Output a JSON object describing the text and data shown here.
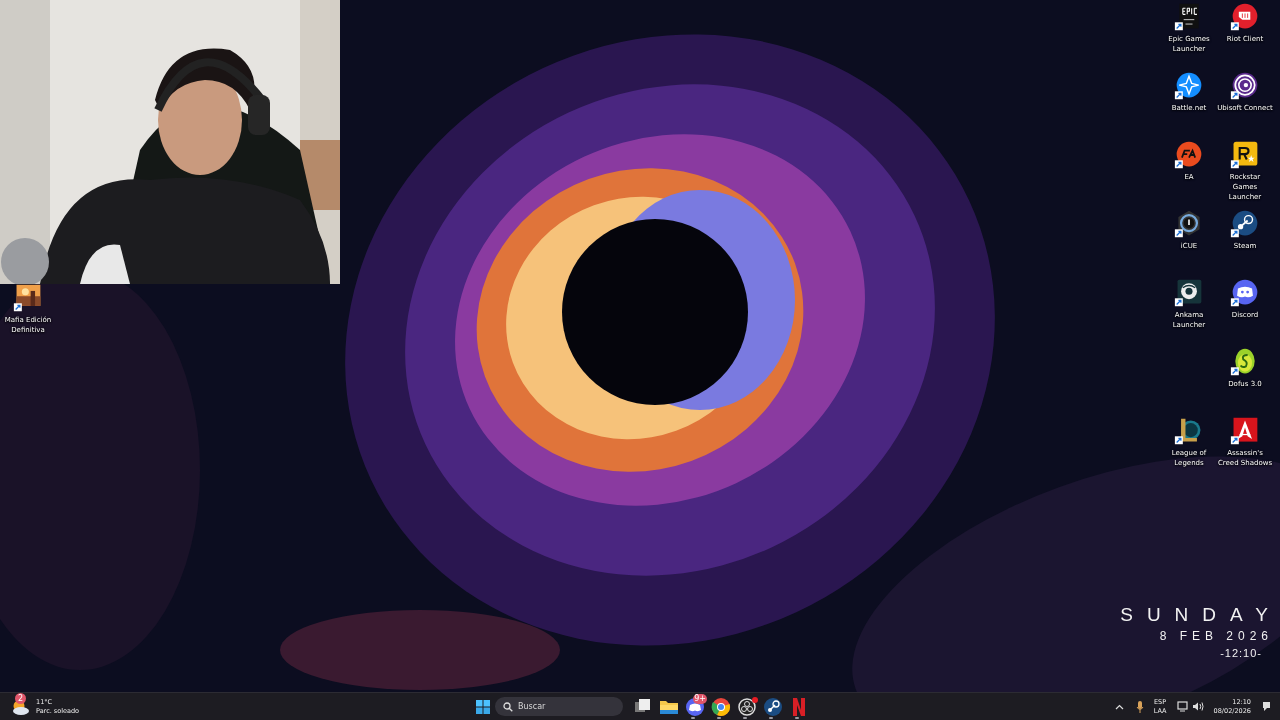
{
  "desktop": {
    "left_icons": [
      {
        "label": "Mafia Edición Definitiva",
        "kind": "mafia"
      }
    ],
    "right_columns": [
      [
        {
          "label": "Epic Games Launcher",
          "kind": "epic"
        },
        {
          "label": "Battle.net",
          "kind": "battlenet"
        },
        {
          "label": "EA",
          "kind": "ea"
        },
        {
          "label": "iCUE",
          "kind": "icue"
        },
        {
          "label": "Ankama Launcher",
          "kind": "ankama"
        },
        null,
        {
          "label": "League of Legends",
          "kind": "league"
        }
      ],
      [
        {
          "label": "Riot Client",
          "kind": "riot"
        },
        {
          "label": "Ubisoft Connect",
          "kind": "ubisoft"
        },
        {
          "label": "Rockstar Games Launcher",
          "kind": "rockstar"
        },
        {
          "label": "Steam",
          "kind": "steam"
        },
        {
          "label": "Discord",
          "kind": "discord"
        },
        {
          "label": "Dofus 3.0",
          "kind": "dofus"
        },
        {
          "label": "Assassin's Creed Shadows",
          "kind": "assassin"
        }
      ]
    ],
    "clock_widget": {
      "day": "SUNDAY",
      "date": "8 FEB 2026",
      "time": "-12:10-"
    }
  },
  "taskbar": {
    "weather": {
      "badge": "2",
      "temperature": "11°C",
      "condition": "Parc. soleado"
    },
    "search": {
      "placeholder": "Buscar"
    },
    "apps": [
      {
        "kind": "taskview",
        "running": false
      },
      {
        "kind": "folder",
        "running": false
      },
      {
        "kind": "discord",
        "running": true,
        "badge": "9+"
      },
      {
        "kind": "chrome",
        "running": true
      },
      {
        "kind": "obs",
        "running": true,
        "alert": true
      },
      {
        "kind": "steam",
        "running": true
      },
      {
        "kind": "netflix",
        "running": true
      }
    ],
    "tray": {
      "language": "ESP",
      "layout": "LAA",
      "time": "12:10",
      "date": "08/02/2026"
    }
  }
}
